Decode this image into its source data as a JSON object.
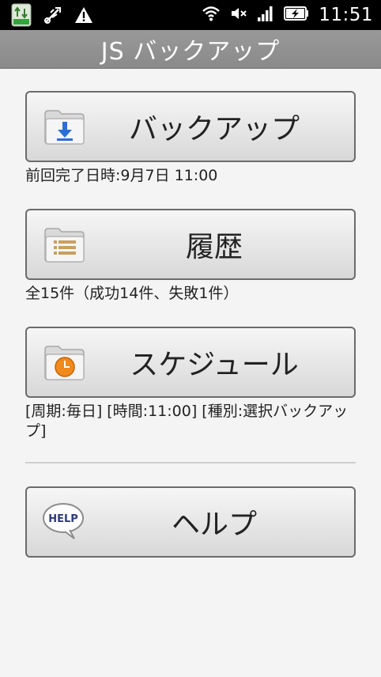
{
  "status_bar": {
    "time": "11:51",
    "left_icons": [
      "app-update-icon",
      "usb-debug-icon",
      "warning-icon"
    ],
    "right_icons": [
      "wifi-icon",
      "mute-icon",
      "signal-icon",
      "battery-charging-icon"
    ]
  },
  "title_bar": {
    "title": "JS バックアップ"
  },
  "main": {
    "backup": {
      "label": "バックアップ",
      "icon": "folder-download-icon",
      "caption": "前回完了日時:9月7日 11:00"
    },
    "history": {
      "label": "履歴",
      "icon": "folder-list-icon",
      "caption": "全15件（成功14件、失敗1件）"
    },
    "schedule": {
      "label": "スケジュール",
      "icon": "folder-clock-icon",
      "caption": "[周期:毎日] [時間:11:00] [種別:選択バックアップ]"
    },
    "help": {
      "label": "ヘルプ",
      "icon": "help-bubble-icon",
      "icon_text": "HELP"
    }
  },
  "colors": {
    "status_bar_bg": "#000000",
    "title_bar_bg": "#8f8f8f",
    "content_bg": "#f4f4f4",
    "button_border": "#6b6b6b",
    "download_arrow": "#2a6fd6",
    "clock_face": "#f08a1c"
  }
}
